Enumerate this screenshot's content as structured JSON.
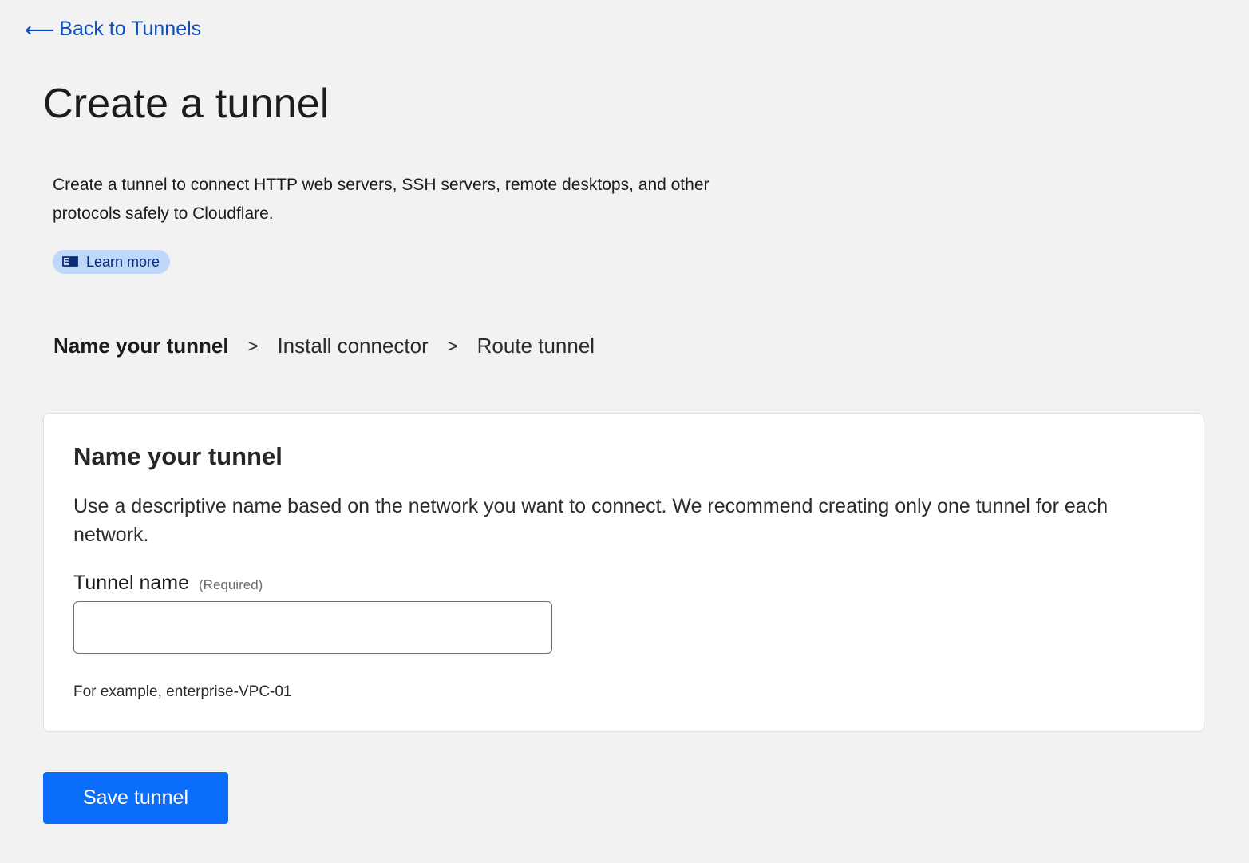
{
  "nav": {
    "back_arrow": "⟵",
    "back_label": "Back to Tunnels"
  },
  "page": {
    "title": "Create a tunnel",
    "intro": "Create a tunnel to connect HTTP web servers, SSH servers, remote desktops, and other protocols safely to Cloudflare.",
    "learn_more_label": "Learn more",
    "learn_more_icon": "book-icon"
  },
  "steps": {
    "items": [
      "Name your tunnel",
      "Install connector",
      "Route tunnel"
    ],
    "separator": ">",
    "active_index": 0
  },
  "form": {
    "title": "Name your tunnel",
    "description": "Use a descriptive name based on the network you want to connect. We recommend creating only one tunnel for each network.",
    "field_label": "Tunnel name",
    "field_required": "(Required)",
    "field_value": "",
    "field_placeholder": "",
    "helper_text": "For example, enterprise-VPC-01"
  },
  "actions": {
    "save_label": "Save tunnel"
  },
  "colors": {
    "link": "#0b4fc1",
    "primary_button": "#0a6dfb",
    "pill_background": "#bfd7fb",
    "page_background": "#f2f2f2"
  }
}
